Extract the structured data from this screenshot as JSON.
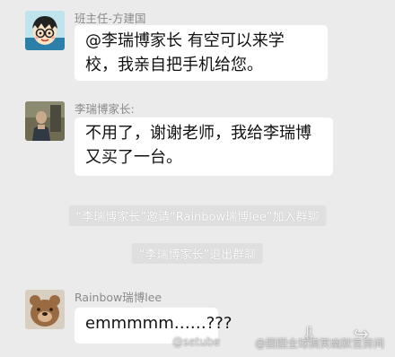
{
  "messages": [
    {
      "sender": "班主任-方建国",
      "lines": [
        "@李瑞博家长 有空可以来学",
        "校，我亲自把手机给您。"
      ],
      "avatar": "cartoon-boy-avatar"
    },
    {
      "sender": "李瑞博家长:",
      "lines": [
        "不用了，谢谢老师，我给李瑞博",
        "又买了一台。"
      ],
      "avatar": "photo-avatar"
    },
    {
      "sender": "Rainbow瑞博lee",
      "lines": [
        "emmmmm……???"
      ],
      "avatar": "bear-avatar"
    }
  ],
  "system_notices": [
    "“李瑞博家长”邀请“Rainbow瑞博lee”加入群聊",
    "“李瑞博家长”退出群聊"
  ],
  "watermarks": {
    "left": "@setube",
    "right": "@图图全球搞笑幽默官房间"
  },
  "colors": {
    "background": "#ebebeb",
    "bubble": "#ffffff",
    "system_notice_bg": "#dfdfdf",
    "name_text": "#8a8a8a"
  }
}
